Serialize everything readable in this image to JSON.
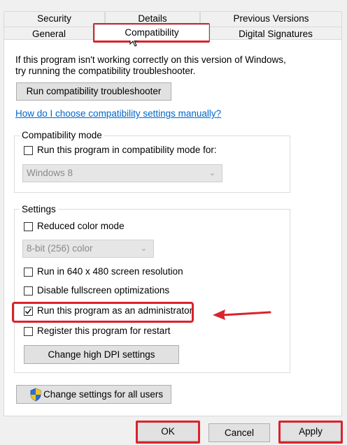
{
  "tabs_row1": [
    "Security",
    "Details",
    "Previous Versions"
  ],
  "tabs_row2": [
    "General",
    "Compatibility",
    "Digital Signatures"
  ],
  "intro_line1": "If this program isn't working correctly on this version of Windows,",
  "intro_line2": "try running the compatibility troubleshooter.",
  "troubleshooter_button": "Run compatibility troubleshooter",
  "manual_link": "How do I choose compatibility settings manually?",
  "compat_mode": {
    "legend": "Compatibility mode",
    "checkbox_label": "Run this program in compatibility mode for:",
    "checked": false,
    "select_value": "Windows 8"
  },
  "settings": {
    "legend": "Settings",
    "reduced_color_label": "Reduced color mode",
    "reduced_color_checked": false,
    "color_select_value": "8-bit (256) color",
    "run_640_label": "Run in 640 x 480 screen resolution",
    "run_640_checked": false,
    "disable_fullscreen_label": "Disable fullscreen optimizations",
    "disable_fullscreen_checked": false,
    "run_admin_label": "Run this program as an administrator",
    "run_admin_checked": true,
    "register_restart_label": "Register this program for restart",
    "register_restart_checked": false,
    "dpi_button": "Change high DPI settings"
  },
  "all_users_button": "Change settings for all users",
  "footer": {
    "ok": "OK",
    "cancel": "Cancel",
    "apply": "Apply"
  },
  "icons": [
    "uac-shield-icon",
    "checkmark-icon",
    "chevron-down-icon",
    "mouse-cursor-icon",
    "annotation-arrow-icon"
  ],
  "colors": {
    "highlight": "#d9232d",
    "link": "#0066cc"
  }
}
